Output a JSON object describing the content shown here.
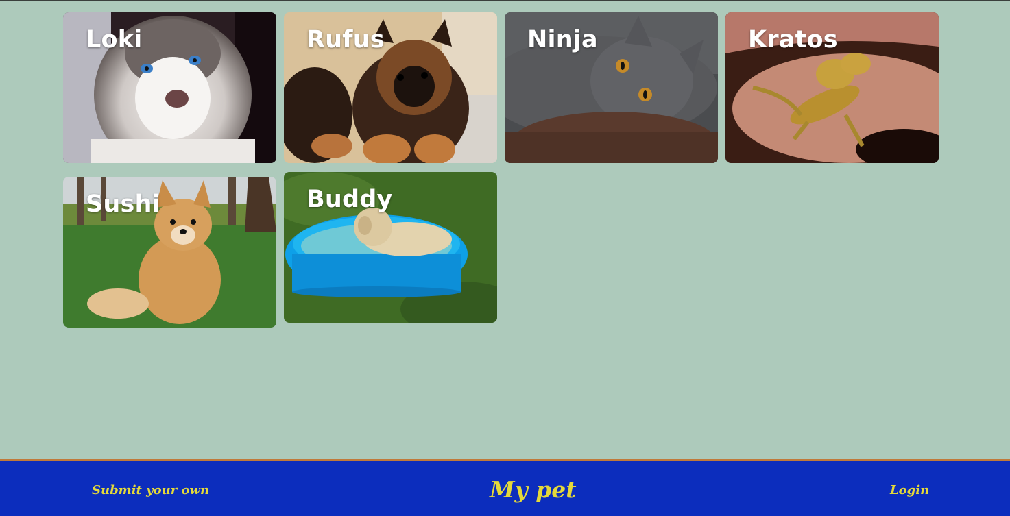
{
  "gallery": {
    "pets": [
      {
        "name": "Loki",
        "image": "husky-puppy-photo"
      },
      {
        "name": "Rufus",
        "image": "german-shepherd-puppy-photo"
      },
      {
        "name": "Ninja",
        "image": "grey-cat-photo"
      },
      {
        "name": "Kratos",
        "image": "bearded-dragon-photo"
      },
      {
        "name": "Sushi",
        "image": "shiba-puppy-photo"
      },
      {
        "name": "Buddy",
        "image": "dog-in-pool-photo"
      }
    ]
  },
  "footer": {
    "submit_label": "Submit your own",
    "brand": "My pet",
    "login_label": "Login"
  },
  "colors": {
    "background": "#adcabb",
    "footer": "#0c2dbd",
    "footer_text": "#e4d93a",
    "footer_border": "#c07a3a"
  }
}
